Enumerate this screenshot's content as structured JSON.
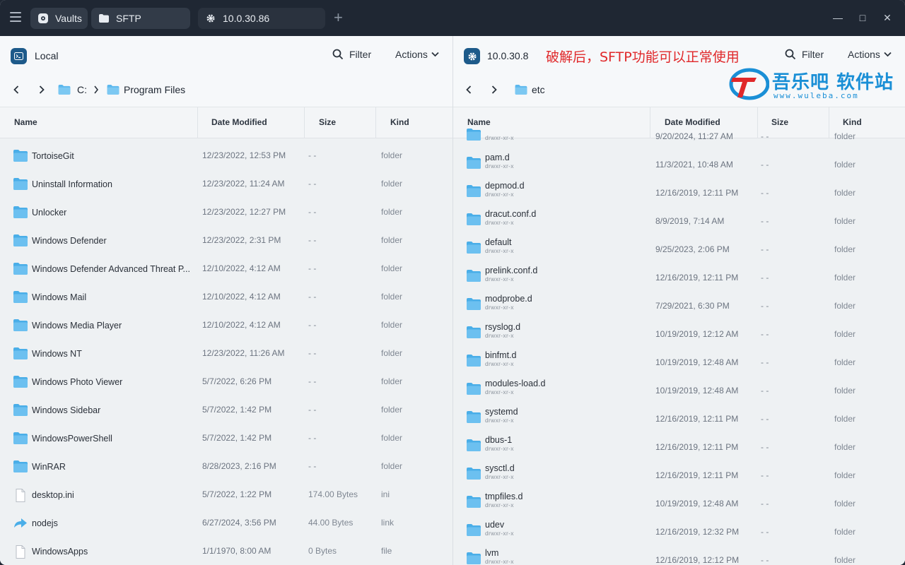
{
  "tabs": [
    {
      "label": "Vaults",
      "icon": "vault-icon"
    },
    {
      "label": "SFTP",
      "icon": "folder-icon"
    },
    {
      "label": "10.0.30.86",
      "icon": "gear-icon"
    }
  ],
  "left": {
    "title": "Local",
    "filter_label": "Filter",
    "actions_label": "Actions",
    "breadcrumb": [
      "C:",
      "Program Files"
    ],
    "columns": [
      "Name",
      "Date Modified",
      "Size",
      "Kind"
    ],
    "rows": [
      {
        "name": "TortoiseGit",
        "date": "12/23/2022, 12:53 PM",
        "size": "- -",
        "kind": "folder",
        "icon": "folder-icon"
      },
      {
        "name": "Uninstall Information",
        "date": "12/23/2022, 11:24 AM",
        "size": "- -",
        "kind": "folder",
        "icon": "folder-icon"
      },
      {
        "name": "Unlocker",
        "date": "12/23/2022, 12:27 PM",
        "size": "- -",
        "kind": "folder",
        "icon": "folder-icon"
      },
      {
        "name": "Windows Defender",
        "date": "12/23/2022, 2:31 PM",
        "size": "- -",
        "kind": "folder",
        "icon": "folder-icon"
      },
      {
        "name": "Windows Defender Advanced Threat P...",
        "date": "12/10/2022, 4:12 AM",
        "size": "- -",
        "kind": "folder",
        "icon": "folder-icon"
      },
      {
        "name": "Windows Mail",
        "date": "12/10/2022, 4:12 AM",
        "size": "- -",
        "kind": "folder",
        "icon": "folder-icon"
      },
      {
        "name": "Windows Media Player",
        "date": "12/10/2022, 4:12 AM",
        "size": "- -",
        "kind": "folder",
        "icon": "folder-icon"
      },
      {
        "name": "Windows NT",
        "date": "12/23/2022, 11:26 AM",
        "size": "- -",
        "kind": "folder",
        "icon": "folder-icon"
      },
      {
        "name": "Windows Photo Viewer",
        "date": "5/7/2022, 6:26 PM",
        "size": "- -",
        "kind": "folder",
        "icon": "folder-icon"
      },
      {
        "name": "Windows Sidebar",
        "date": "5/7/2022, 1:42 PM",
        "size": "- -",
        "kind": "folder",
        "icon": "folder-icon"
      },
      {
        "name": "WindowsPowerShell",
        "date": "5/7/2022, 1:42 PM",
        "size": "- -",
        "kind": "folder",
        "icon": "folder-icon"
      },
      {
        "name": "WinRAR",
        "date": "8/28/2023, 2:16 PM",
        "size": "- -",
        "kind": "folder",
        "icon": "folder-icon"
      },
      {
        "name": "desktop.ini",
        "date": "5/7/2022, 1:22 PM",
        "size": "174.00 Bytes",
        "kind": "ini",
        "icon": "file-icon"
      },
      {
        "name": "nodejs",
        "date": "6/27/2024, 3:56 PM",
        "size": "44.00 Bytes",
        "kind": "link",
        "icon": "link-icon"
      },
      {
        "name": "WindowsApps",
        "date": "1/1/1970, 8:00 AM",
        "size": "0 Bytes",
        "kind": "file",
        "icon": "file-icon"
      }
    ]
  },
  "right": {
    "title": "10.0.30.8",
    "filter_label": "Filter",
    "actions_label": "Actions",
    "breadcrumb": [
      "etc"
    ],
    "columns": [
      "Name",
      "Date Modified",
      "Size",
      "Kind"
    ],
    "rows": [
      {
        "name": "",
        "perm": "drwxr-xr-x",
        "date": "9/20/2024, 11:27 AM",
        "size": "- -",
        "kind": "folder",
        "icon": "folder-icon"
      },
      {
        "name": "pam.d",
        "perm": "drwxr-xr-x",
        "date": "11/3/2021, 10:48 AM",
        "size": "- -",
        "kind": "folder",
        "icon": "folder-icon"
      },
      {
        "name": "depmod.d",
        "perm": "drwxr-xr-x",
        "date": "12/16/2019, 12:11 PM",
        "size": "- -",
        "kind": "folder",
        "icon": "folder-icon"
      },
      {
        "name": "dracut.conf.d",
        "perm": "drwxr-xr-x",
        "date": "8/9/2019, 7:14 AM",
        "size": "- -",
        "kind": "folder",
        "icon": "folder-icon"
      },
      {
        "name": "default",
        "perm": "drwxr-xr-x",
        "date": "9/25/2023, 2:06 PM",
        "size": "- -",
        "kind": "folder",
        "icon": "folder-icon"
      },
      {
        "name": "prelink.conf.d",
        "perm": "drwxr-xr-x",
        "date": "12/16/2019, 12:11 PM",
        "size": "- -",
        "kind": "folder",
        "icon": "folder-icon"
      },
      {
        "name": "modprobe.d",
        "perm": "drwxr-xr-x",
        "date": "7/29/2021, 6:30 PM",
        "size": "- -",
        "kind": "folder",
        "icon": "folder-icon"
      },
      {
        "name": "rsyslog.d",
        "perm": "drwxr-xr-x",
        "date": "10/19/2019, 12:12 AM",
        "size": "- -",
        "kind": "folder",
        "icon": "folder-icon"
      },
      {
        "name": "binfmt.d",
        "perm": "drwxr-xr-x",
        "date": "10/19/2019, 12:48 AM",
        "size": "- -",
        "kind": "folder",
        "icon": "folder-icon"
      },
      {
        "name": "modules-load.d",
        "perm": "drwxr-xr-x",
        "date": "10/19/2019, 12:48 AM",
        "size": "- -",
        "kind": "folder",
        "icon": "folder-icon"
      },
      {
        "name": "systemd",
        "perm": "drwxr-xr-x",
        "date": "12/16/2019, 12:11 PM",
        "size": "- -",
        "kind": "folder",
        "icon": "folder-icon"
      },
      {
        "name": "dbus-1",
        "perm": "drwxr-xr-x",
        "date": "12/16/2019, 12:11 PM",
        "size": "- -",
        "kind": "folder",
        "icon": "folder-icon"
      },
      {
        "name": "sysctl.d",
        "perm": "drwxr-xr-x",
        "date": "12/16/2019, 12:11 PM",
        "size": "- -",
        "kind": "folder",
        "icon": "folder-icon"
      },
      {
        "name": "tmpfiles.d",
        "perm": "drwxr-xr-x",
        "date": "10/19/2019, 12:48 AM",
        "size": "- -",
        "kind": "folder",
        "icon": "folder-icon"
      },
      {
        "name": "udev",
        "perm": "drwxr-xr-x",
        "date": "12/16/2019, 12:32 PM",
        "size": "- -",
        "kind": "folder",
        "icon": "folder-icon"
      },
      {
        "name": "lvm",
        "perm": "drwxr-xr-x",
        "date": "12/16/2019, 12:12 PM",
        "size": "- -",
        "kind": "folder",
        "icon": "folder-icon"
      }
    ]
  },
  "annotation": "破解后，SFTP功能可以正常使用",
  "watermark": {
    "title": "吾乐吧 软件站",
    "subtitle": "www.wuleba.com"
  },
  "colors": {
    "titlebar": "#1f2733",
    "folder": "#5cb8ee",
    "annotation": "#e0282a",
    "watermark": "#1a8fd6"
  }
}
